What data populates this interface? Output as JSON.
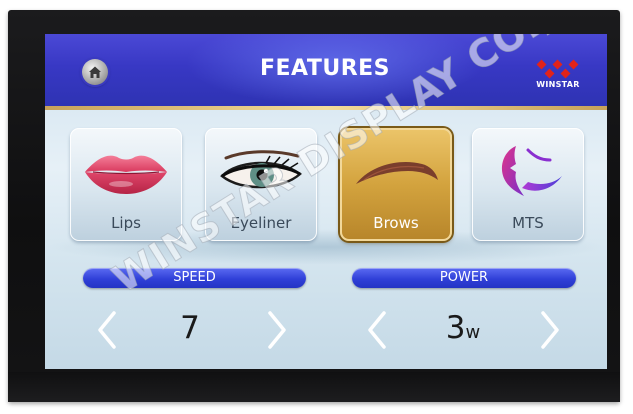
{
  "header": {
    "title": "FEATURES",
    "home_icon": "home-icon",
    "logo_text": "WINSTAR"
  },
  "features": [
    {
      "label": "Lips",
      "icon": "lips-icon",
      "selected": false
    },
    {
      "label": "Eyeliner",
      "icon": "eye-icon",
      "selected": false
    },
    {
      "label": "Brows",
      "icon": "eyebrow-icon",
      "selected": true
    },
    {
      "label": "MTS",
      "icon": "face-profile-icon",
      "selected": false
    }
  ],
  "speed": {
    "label": "SPEED",
    "value": "7"
  },
  "power": {
    "label": "POWER",
    "value": "3",
    "unit": "w"
  },
  "watermark": "WINSTAR DISPLAY CO.,LTD",
  "colors": {
    "header_blue": "#3838c4",
    "pill_blue": "#3040d8",
    "selected_gold": "#d3a33e",
    "accent_red": "#e2231a"
  }
}
